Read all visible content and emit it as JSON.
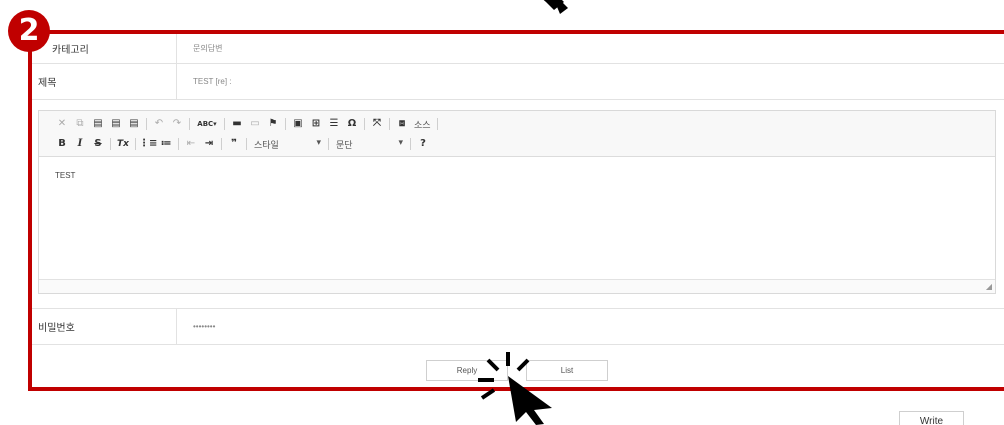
{
  "step_number": "2",
  "form": {
    "category": {
      "label": "카테고리",
      "value": "문의답변"
    },
    "title": {
      "label": "제목",
      "value": "TEST [re] :"
    },
    "editor": {
      "toolbar_row1": [
        "✕",
        "⧉",
        "▤",
        "▤",
        "▤",
        "↶",
        "↷",
        "ABC▾",
        "▬",
        "▭",
        "⚑",
        "▣",
        "⊞",
        "☰",
        "Ω",
        "⤧",
        "⧈"
      ],
      "source_label": "소스",
      "toolbar_row2": [
        "B",
        "I",
        "S",
        "Tx",
        "⋮≡",
        "≔",
        "⇤",
        "⇥",
        "❞"
      ],
      "style_combo": "스타일",
      "paragraph_combo": "문단",
      "help": "?",
      "content": "TEST"
    },
    "password": {
      "label": "비밀번호",
      "value": "••••••••"
    }
  },
  "buttons": {
    "reply": "Reply",
    "list": "List"
  },
  "write_button": "Write"
}
